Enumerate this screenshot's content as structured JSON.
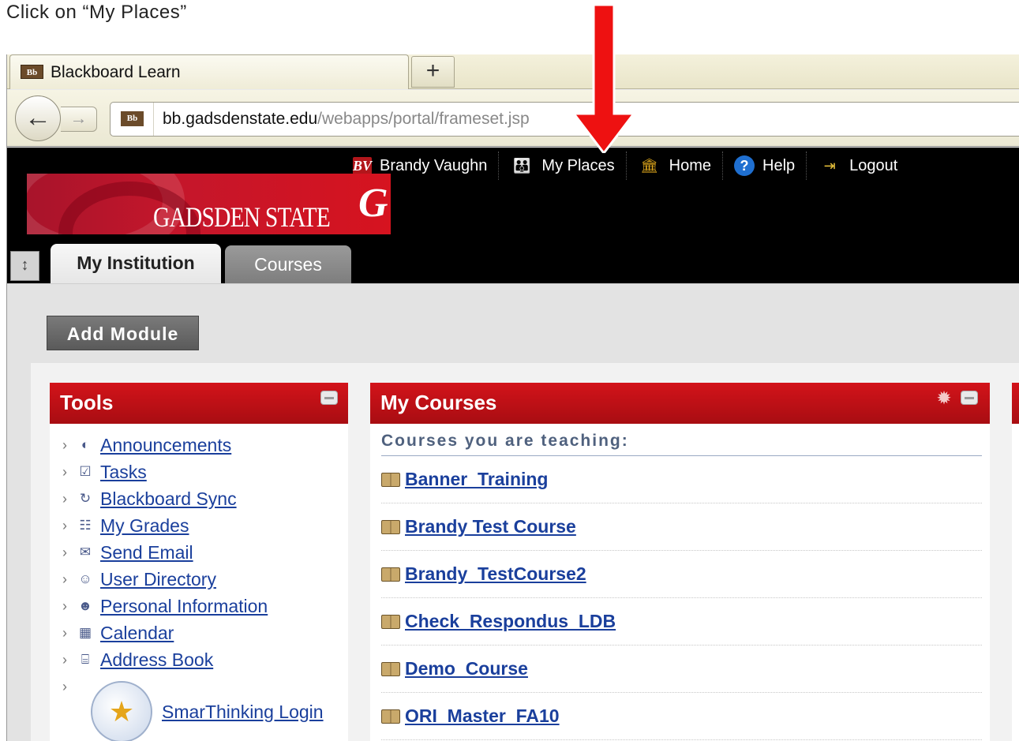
{
  "instruction": "Click on “My Places”",
  "browser": {
    "tab_title": "Blackboard Learn",
    "favicon_text": "Bb",
    "new_tab_label": "+",
    "url_host": "bb.gadsdenstate.edu",
    "url_path": "/webapps/portal/frameset.jsp"
  },
  "header": {
    "user_initials": "BV",
    "user_name": "Brandy Vaughn",
    "links": {
      "my_places": "My Places",
      "home": "Home",
      "help": "Help",
      "logout": "Logout"
    },
    "logo_text": "GADSDEN STATE"
  },
  "tabs": {
    "active": "My Institution",
    "inactive": "Courses"
  },
  "buttons": {
    "add_module": "Add Module"
  },
  "tools_module": {
    "title": "Tools",
    "items": [
      {
        "label": "Announcements",
        "icon": "megaphone-icon"
      },
      {
        "label": "Tasks",
        "icon": "clipboard-icon"
      },
      {
        "label": "Blackboard Sync",
        "icon": "sync-icon"
      },
      {
        "label": "My Grades",
        "icon": "grades-icon"
      },
      {
        "label": "Send Email",
        "icon": "envelope-icon"
      },
      {
        "label": "User Directory",
        "icon": "directory-icon"
      },
      {
        "label": "Personal Information",
        "icon": "person-card-icon"
      },
      {
        "label": "Calendar",
        "icon": "calendar-icon"
      },
      {
        "label": "Address Book",
        "icon": "address-book-icon"
      }
    ],
    "smarthinking": "SmarThinking Login"
  },
  "courses_module": {
    "title": "My Courses",
    "subheading": "Courses you are teaching:",
    "courses": [
      "Banner_Training",
      "Brandy Test Course",
      "Brandy_TestCourse2",
      "Check_Respondus_LDB",
      "Demo_Course",
      "ORI_Master_FA10"
    ]
  },
  "colors": {
    "module_header": "#c4121a",
    "link": "#1a3f9c",
    "arrow": "#ee1111"
  }
}
